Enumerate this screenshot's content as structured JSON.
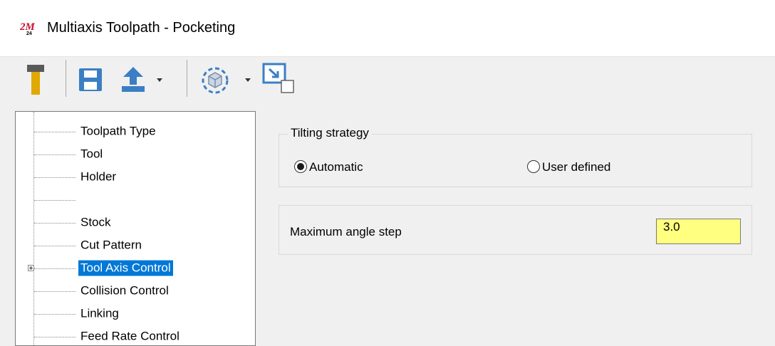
{
  "window": {
    "title": "Multiaxis Toolpath - Pocketing",
    "logo_icon": "mastercam-logo-icon"
  },
  "toolbar": {
    "items": [
      {
        "icon": "tool-icon"
      },
      {
        "icon": "save-icon"
      },
      {
        "icon": "upload-icon",
        "dropdown": true
      },
      {
        "icon": "stock-view-icon",
        "dropdown": true
      },
      {
        "icon": "minimize-dialog-icon"
      }
    ]
  },
  "tree": {
    "items": [
      {
        "label": "Toolpath Type",
        "selected": false
      },
      {
        "label": "Tool",
        "selected": false
      },
      {
        "label": "Holder",
        "selected": false
      },
      {
        "label": "",
        "selected": false
      },
      {
        "label": "Stock",
        "selected": false
      },
      {
        "label": "Cut Pattern",
        "selected": false
      },
      {
        "label": "Tool Axis Control",
        "selected": true,
        "expandable": true
      },
      {
        "label": "Collision Control",
        "selected": false
      },
      {
        "label": "Linking",
        "selected": false
      },
      {
        "label": "Feed Rate Control",
        "selected": false
      }
    ]
  },
  "tilting": {
    "title": "Tilting strategy",
    "options": [
      {
        "label": "Automatic",
        "checked": true
      },
      {
        "label": "User defined",
        "checked": false
      }
    ]
  },
  "angle_step": {
    "label": "Maximum angle step",
    "value": "3.0"
  },
  "colors": {
    "selection": "#0078d7",
    "input_highlight": "#ffff80",
    "save_icon": "#3a7fc4",
    "tool_icon": "#e0a800"
  }
}
